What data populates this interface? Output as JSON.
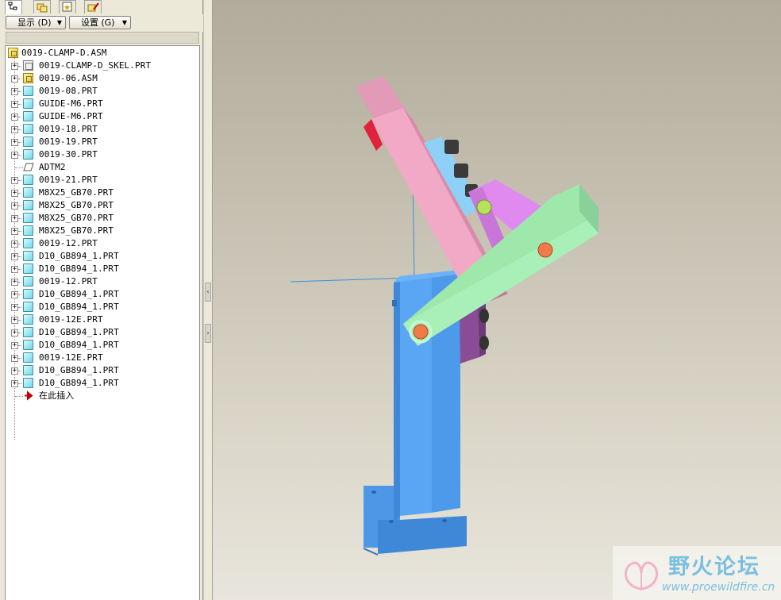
{
  "toolbar": {
    "show_label": "显示 (D)",
    "settings_label": "设置 (G)"
  },
  "tree": {
    "root": "0019-CLAMP-D.ASM",
    "items": [
      {
        "label": "0019-CLAMP-D_SKEL.PRT",
        "icon": "skeleton-icon",
        "expandable": true
      },
      {
        "label": "0019-06.ASM",
        "icon": "assembly-icon",
        "expandable": true
      },
      {
        "label": "0019-08.PRT",
        "icon": "part-icon",
        "expandable": true
      },
      {
        "label": "GUIDE-M6.PRT",
        "icon": "part-icon",
        "expandable": true
      },
      {
        "label": "GUIDE-M6.PRT",
        "icon": "part-icon",
        "expandable": true
      },
      {
        "label": "0019-18.PRT",
        "icon": "part-icon",
        "expandable": true
      },
      {
        "label": "0019-19.PRT",
        "icon": "part-icon",
        "expandable": true
      },
      {
        "label": "0019-30.PRT",
        "icon": "part-icon",
        "expandable": true
      },
      {
        "label": "ADTM2",
        "icon": "datum-plane-icon",
        "expandable": false
      },
      {
        "label": "0019-21.PRT",
        "icon": "part-icon",
        "expandable": true
      },
      {
        "label": "M8X25_GB70.PRT",
        "icon": "part-icon",
        "expandable": true
      },
      {
        "label": "M8X25_GB70.PRT",
        "icon": "part-icon",
        "expandable": true
      },
      {
        "label": "M8X25_GB70.PRT",
        "icon": "part-icon",
        "expandable": true
      },
      {
        "label": "M8X25_GB70.PRT",
        "icon": "part-icon",
        "expandable": true
      },
      {
        "label": "0019-12.PRT",
        "icon": "part-icon",
        "expandable": true
      },
      {
        "label": "D10_GB894_1.PRT",
        "icon": "part-icon",
        "expandable": true
      },
      {
        "label": "D10_GB894_1.PRT",
        "icon": "part-icon",
        "expandable": true
      },
      {
        "label": "0019-12.PRT",
        "icon": "part-icon",
        "expandable": true
      },
      {
        "label": "D10_GB894_1.PRT",
        "icon": "part-icon",
        "expandable": true
      },
      {
        "label": "D10_GB894_1.PRT",
        "icon": "part-icon",
        "expandable": true
      },
      {
        "label": "0019-12E.PRT",
        "icon": "part-icon",
        "expandable": true
      },
      {
        "label": "D10_GB894_1.PRT",
        "icon": "part-icon",
        "expandable": true
      },
      {
        "label": "D10_GB894_1.PRT",
        "icon": "part-icon",
        "expandable": true
      },
      {
        "label": "0019-12E.PRT",
        "icon": "part-icon",
        "expandable": true
      },
      {
        "label": "D10_GB894_1.PRT",
        "icon": "part-icon",
        "expandable": true
      },
      {
        "label": "D10_GB894_1.PRT",
        "icon": "part-icon",
        "expandable": true
      },
      {
        "label": "在此插入",
        "icon": "insert-here-arrow-icon",
        "expandable": false
      }
    ]
  },
  "watermark": {
    "title": "野火论坛",
    "url": "www.proewildfire.cn"
  },
  "colors": {
    "base_blue": "#5aa6f5",
    "arm_pink": "#f2a9c6",
    "link_green": "#a8f0b8",
    "link_violet": "#e08af0",
    "pin_orange": "#f07a4a",
    "block_purple": "#8a4c96"
  }
}
